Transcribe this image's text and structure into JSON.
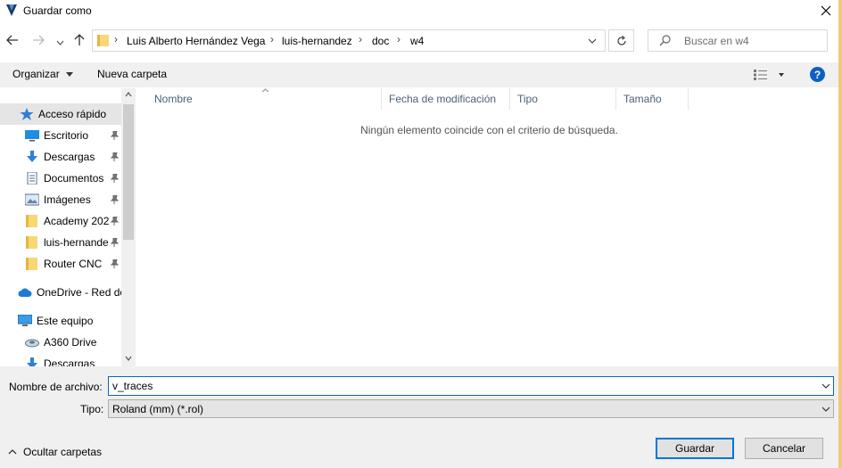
{
  "window": {
    "title": "Guardar como"
  },
  "address": {
    "crumbs": [
      "Luis Alberto Hernández Vega",
      "luis-hernandez",
      "doc",
      "w4"
    ]
  },
  "search": {
    "placeholder": "Buscar en w4"
  },
  "toolbar": {
    "organize_label": "Organizar",
    "new_folder_label": "Nueva carpeta"
  },
  "sidebar": {
    "items": [
      {
        "label": "Acceso rápido",
        "icon": "star-icon",
        "pinned": false
      },
      {
        "label": "Escritorio",
        "icon": "desktop-icon",
        "pinned": true
      },
      {
        "label": "Descargas",
        "icon": "download-icon",
        "pinned": true
      },
      {
        "label": "Documentos",
        "icon": "document-icon",
        "pinned": true
      },
      {
        "label": "Imágenes",
        "icon": "image-icon",
        "pinned": true
      },
      {
        "label": "Academy 202",
        "icon": "folder-icon",
        "pinned": true
      },
      {
        "label": "luis-hernande",
        "icon": "folder-icon",
        "pinned": true
      },
      {
        "label": "Router CNC",
        "icon": "folder-icon",
        "pinned": true
      },
      {
        "label": "OneDrive - Red de",
        "icon": "cloud-icon",
        "pinned": false
      },
      {
        "label": "Este equipo",
        "icon": "computer-icon",
        "pinned": false
      },
      {
        "label": "A360 Drive",
        "icon": "drive-icon",
        "pinned": false
      },
      {
        "label": "Descargas",
        "icon": "download-icon",
        "pinned": false
      }
    ]
  },
  "columns": [
    "Nombre",
    "Fecha de modificación",
    "Tipo",
    "Tamaño"
  ],
  "empty_message": "Ningún elemento coincide con el criterio de búsqueda.",
  "form": {
    "filename_label": "Nombre de archivo:",
    "filename_value": "v_traces",
    "type_label": "Tipo:",
    "type_value": "Roland (mm) (*.rol)"
  },
  "footer": {
    "hide_folders_label": "Ocultar carpetas",
    "save_label": "Guardar",
    "cancel_label": "Cancelar"
  },
  "colors": {
    "accent": "#0078d7",
    "folder": "#f8d775",
    "help": "#0f5fc2"
  }
}
